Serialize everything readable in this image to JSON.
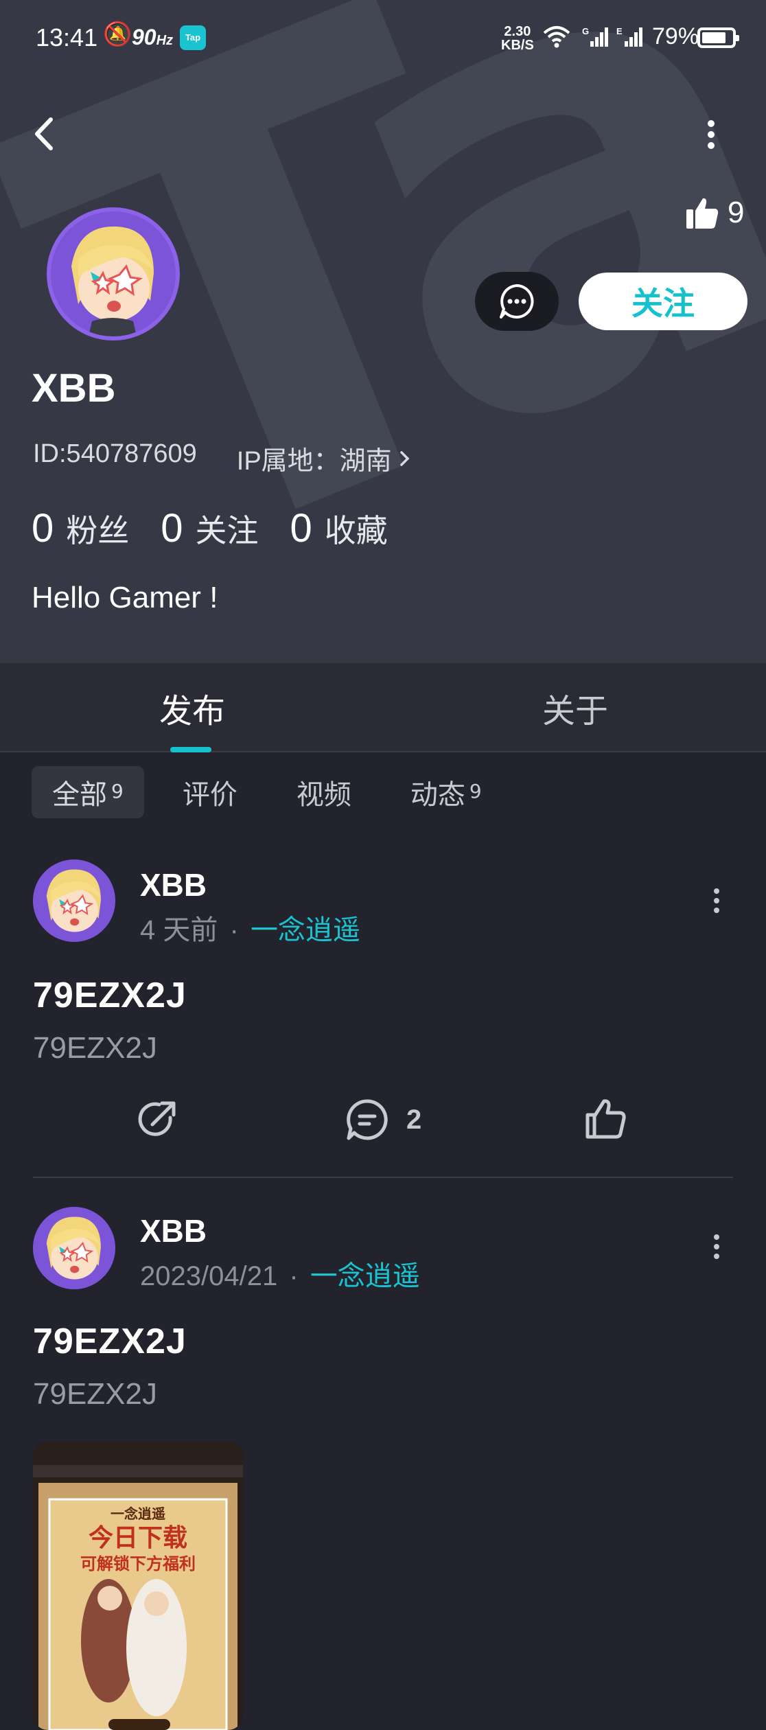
{
  "status_bar": {
    "time": "13:41",
    "refresh_rate": "90",
    "refresh_unit": "Hz",
    "app_badge": "Tap",
    "net_speed_value": "2.30",
    "net_speed_unit": "KB/S",
    "sig1_label": "G",
    "sig2_label": "E",
    "battery": "79%"
  },
  "profile": {
    "like_count": "9",
    "username": "XBB",
    "id_text": "ID:540787609",
    "ip_text": "IP属地：湖南",
    "follow_label": "关注",
    "stats": [
      {
        "num": "0",
        "label": "粉丝"
      },
      {
        "num": "0",
        "label": "关注"
      },
      {
        "num": "0",
        "label": "收藏"
      }
    ],
    "bio": "Hello Gamer !"
  },
  "tabs": [
    {
      "label": "发布"
    },
    {
      "label": "关于"
    }
  ],
  "filters": [
    {
      "label": "全部",
      "count": "9"
    },
    {
      "label": "评价",
      "count": ""
    },
    {
      "label": "视频",
      "count": ""
    },
    {
      "label": "动态",
      "count": "9"
    }
  ],
  "posts": [
    {
      "author": "XBB",
      "time": "4 天前",
      "sep": "·",
      "app": "一念逍遥",
      "title": "79EZX2J",
      "body": "79EZX2J",
      "comment_count": "2"
    },
    {
      "author": "XBB",
      "time": "2023/04/21",
      "sep": "·",
      "app": "一念逍遥",
      "title": "79EZX2J",
      "body": "79EZX2J"
    }
  ],
  "thumbnail_text": {
    "line1": "一念逍遥",
    "line2": "今日下载",
    "line3": "可解锁下方福利"
  },
  "colors": {
    "accent": "#15c1cb",
    "header_bg": "#363945",
    "page_bg": "#22232c"
  }
}
